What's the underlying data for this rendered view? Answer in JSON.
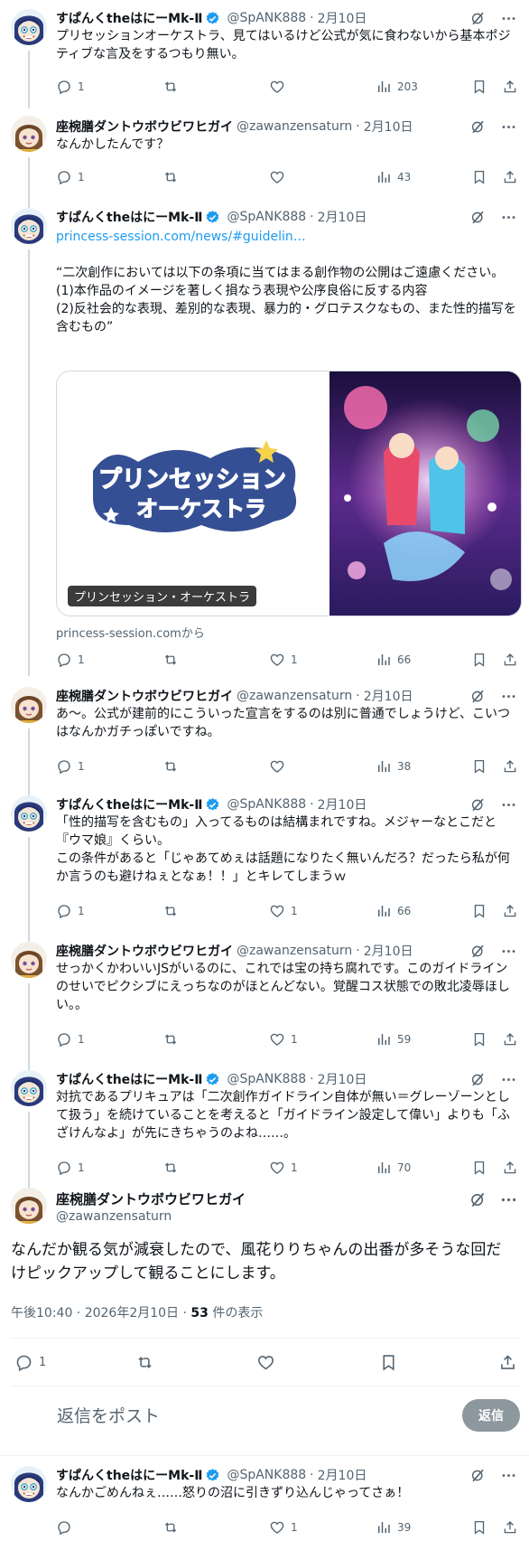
{
  "users": {
    "spank": {
      "name": "すぱんくtheはにーMk-Ⅱ",
      "handle": "@SpANK888"
    },
    "zawa": {
      "name": "座椀膳ダントウボウビワヒガイ",
      "handle": "@zawanzensaturn"
    }
  },
  "sep": "·",
  "tweets": [
    {
      "date": "2月10日",
      "text": "プリセッションオーケストラ、見てはいるけど公式が気に食わないから基本ポジティブな言及をするつもり無い。",
      "reply": "1",
      "retweet": "",
      "like": "",
      "views": "203"
    },
    {
      "date": "2月10日",
      "text": "なんかしたんです？",
      "reply": "1",
      "retweet": "",
      "like": "",
      "views": "43"
    },
    {
      "date": "2月10日",
      "link": "princess-session.com/news/#guidelin…",
      "text": "“二次創作においては以下の条項に当てはまる創作物の公開はご遠慮ください。\n(1)本作品のイメージを著しく損なう表現や公序良俗に反する内容\n(2)反社会的な表現、差別的な表現、暴力的・グロテスクなもの、また性的描写を含むもの”",
      "card_label": "プリンセッション・オーケストラ",
      "card_logo": "プリンセッション オーケストラ",
      "card_source": "princess-session.comから",
      "reply": "1",
      "retweet": "",
      "like": "1",
      "views": "66"
    },
    {
      "date": "2月10日",
      "text": "あ〜。公式が建前的にこういった宣言をするのは別に普通でしょうけど、こいつはなんかガチっぽいですね。",
      "reply": "1",
      "retweet": "",
      "like": "",
      "views": "38"
    },
    {
      "date": "2月10日",
      "text": "「性的描写を含むもの」入ってるものは結構まれですね。メジャーなとこだと『ウマ娘』くらい。\nこの条件があると「じゃあてめぇは話題になりたく無いんだろ？だったら私が何か言うのも避けねぇとなぁ！！」とキレてしまうｗ",
      "reply": "1",
      "retweet": "",
      "like": "1",
      "views": "66"
    },
    {
      "date": "2月10日",
      "text": "せっかくかわいいJSがいるのに、これでは宝の持ち腐れです。このガイドラインのせいでピクシブにえっちなのがほとんどない。覚醒コス状態での敗北凌辱ほしい。。",
      "reply": "1",
      "retweet": "",
      "like": "1",
      "views": "59"
    },
    {
      "date": "2月10日",
      "text": "対抗であるプリキュアは「二次創作ガイドライン自体が無い＝グレーゾーンとして扱う」を続けていることを考えると「ガイドライン設定して偉い」よりも「ふざけんなよ」が先にきちゃうのよね……。",
      "reply": "1",
      "retweet": "",
      "like": "1",
      "views": "70"
    }
  ],
  "focused": {
    "text": "なんだか観る気が減衰したので、風花りりちゃんの出番が多そうな回だけピックアップして観ることにします。",
    "time": "午後10:40 · 2026年2月10日 · ",
    "views_count": "53",
    "views_suffix": " 件の表示",
    "reply": "1"
  },
  "reply_box": {
    "placeholder": "返信をポスト",
    "button": "返信"
  },
  "last": {
    "date": "2月10日",
    "text": "なんかごめんねぇ……怒りの沼に引きずり込んじゃってさぁ！",
    "reply": "",
    "retweet": "",
    "like": "1",
    "views": "39"
  },
  "colors": {
    "accent": "#1d9bf0",
    "text": "#0f1419",
    "muted": "#536471",
    "line": "#cfd9de"
  },
  "icons": [
    "reply-icon",
    "retweet-icon",
    "like-icon",
    "views-icon",
    "bookmark-icon",
    "share-icon",
    "grok-icon",
    "more-icon",
    "verified-badge-icon"
  ]
}
